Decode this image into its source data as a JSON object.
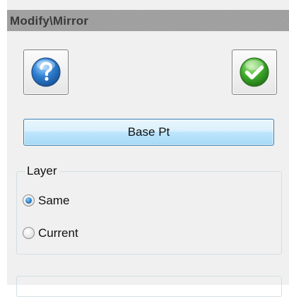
{
  "title": "Modify\\Mirror",
  "toolbar": {
    "help_icon": "help-icon",
    "ok_icon": "checkmark-icon"
  },
  "base_button": {
    "label": "Base Pt"
  },
  "layer_group": {
    "label": "Layer",
    "options": [
      {
        "label": "Same",
        "selected": true
      },
      {
        "label": "Current",
        "selected": false
      }
    ]
  },
  "colors": {
    "title_bar": "#9e9e9e",
    "accent_blue": "#3c7fb1",
    "panel_bg": "#f0f0f0",
    "ok_green": "#3fae2a"
  }
}
